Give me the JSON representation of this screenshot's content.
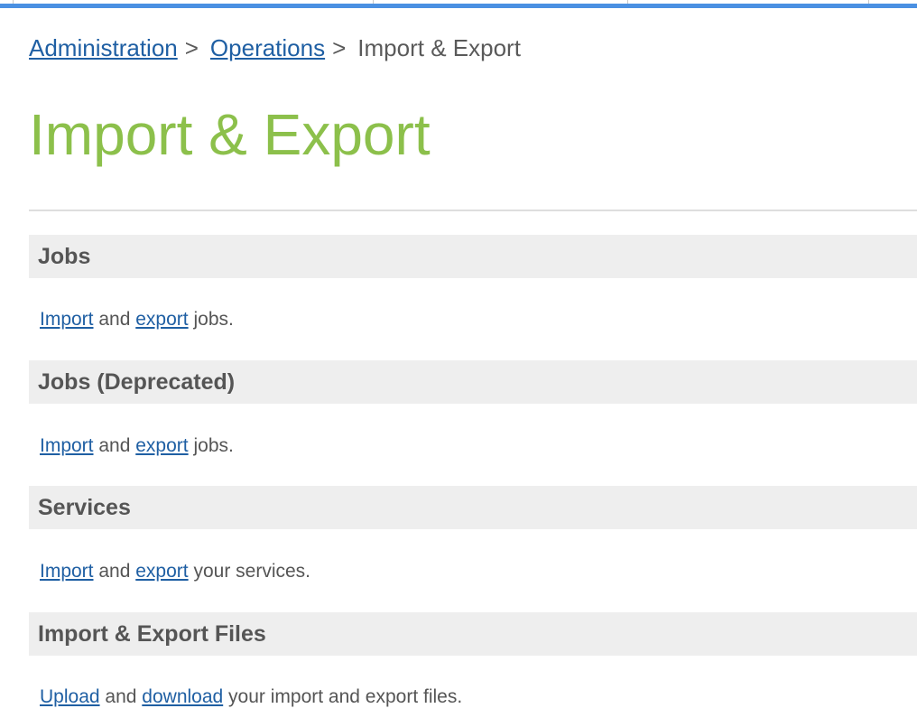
{
  "colors": {
    "accent_bar": "#4a90e2",
    "title_green": "#8cc04b",
    "link_blue": "#1f5fa3",
    "section_bg": "#eeeeee",
    "text_gray": "#555555"
  },
  "breadcrumb": {
    "items": [
      {
        "label": "Administration"
      },
      {
        "label": "Operations"
      }
    ],
    "separator": ">",
    "current": "Import & Export"
  },
  "page": {
    "title": "Import & Export"
  },
  "sections": [
    {
      "title": "Jobs",
      "link1": "Import",
      "conj": "and",
      "link2": "export",
      "rest": "jobs."
    },
    {
      "title": "Jobs (Deprecated)",
      "link1": "Import",
      "conj": "and",
      "link2": "export",
      "rest": "jobs."
    },
    {
      "title": "Services",
      "link1": "Import",
      "conj": "and",
      "link2": "export",
      "rest": "your services."
    },
    {
      "title": "Import & Export Files",
      "link1": "Upload",
      "conj": "and",
      "link2": "download",
      "rest": "your import and export files."
    }
  ]
}
